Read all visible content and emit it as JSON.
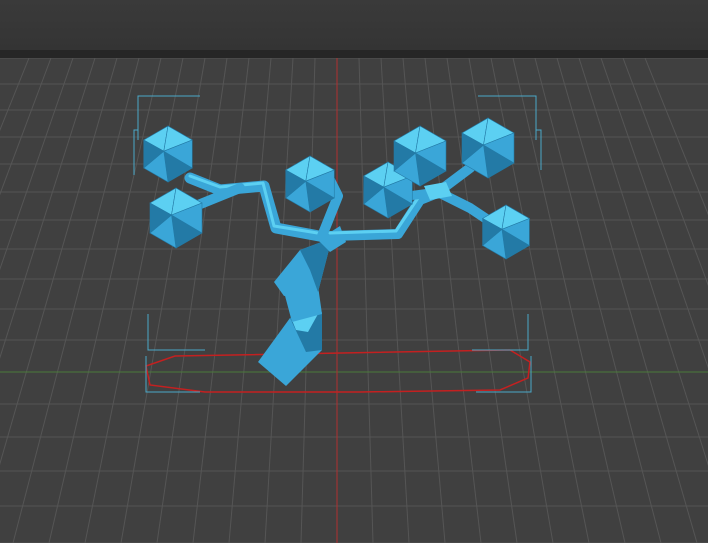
{
  "window": {
    "header_title": ""
  },
  "viewport": {
    "background_color": "#404040",
    "grid_color": "#555555",
    "x_axis_color": "#4a7a3a",
    "y_axis_color": "#b03030",
    "model": {
      "name": "tree-support-model",
      "color": "#3aa6d8",
      "highlight_color": "#5cd0f2",
      "shadow_color": "#237aa6"
    },
    "bounding_box_color": "#4aa8c8",
    "footprint_outline_color": "#c42020"
  }
}
